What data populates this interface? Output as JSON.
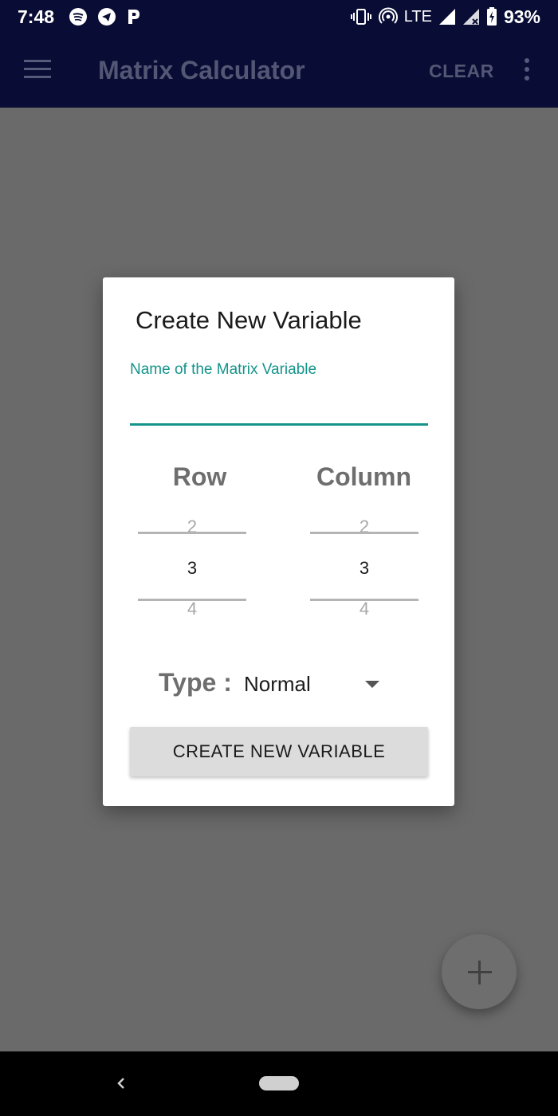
{
  "status_bar": {
    "time": "7:48",
    "network": "LTE",
    "battery": "93%"
  },
  "app_bar": {
    "title": "Matrix Calculator",
    "clear_label": "CLEAR"
  },
  "dialog": {
    "title": "Create New Variable",
    "name_label": "Name of the Matrix Variable",
    "name_value": "",
    "row_header": "Row",
    "column_header": "Column",
    "row_picker": {
      "prev": "2",
      "current": "3",
      "next": "4"
    },
    "column_picker": {
      "prev": "2",
      "current": "3",
      "next": "4"
    },
    "type_label": "Type :",
    "type_value": "Normal",
    "create_button_label": "CREATE NEW VARIABLE"
  },
  "colors": {
    "app_bar_bg": "#090c34",
    "accent": "#14948a",
    "scrim": "#6a6a6a"
  }
}
